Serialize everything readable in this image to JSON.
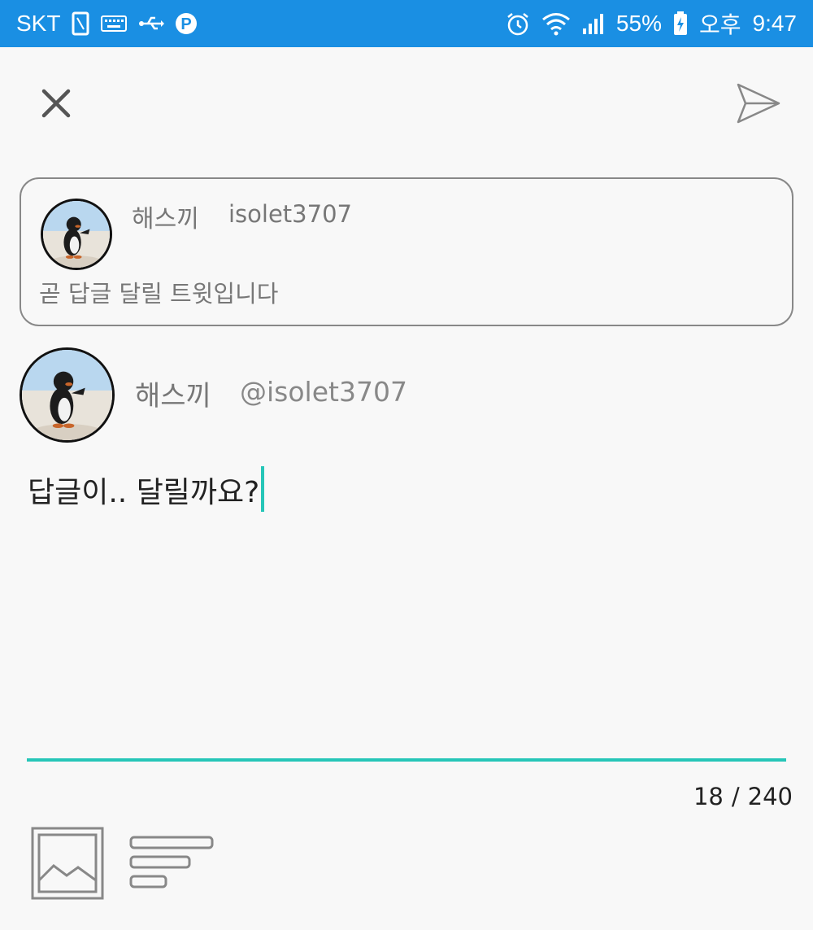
{
  "status_bar": {
    "carrier": "SKT",
    "p_badge": "P",
    "battery": "55%",
    "ampm": "오후",
    "time": "9:47",
    "bg_color": "#1a8fe3"
  },
  "top_bar": {
    "close_icon": "close-icon",
    "send_icon": "send-icon"
  },
  "quoted_tweet": {
    "display_name": "해스끼",
    "handle": "isolet3707",
    "text": "곧 답글 달릴 트윗입니다"
  },
  "author": {
    "display_name": "해스끼",
    "handle": "@isolet3707"
  },
  "compose": {
    "text": "답글이.. 달릴까요?",
    "char_count": "18",
    "separator": "/",
    "max_chars": "240",
    "accent_color": "#26c6b8"
  },
  "toolbar": {
    "image_icon": "image-icon",
    "format_icon": "text-format-icon"
  }
}
